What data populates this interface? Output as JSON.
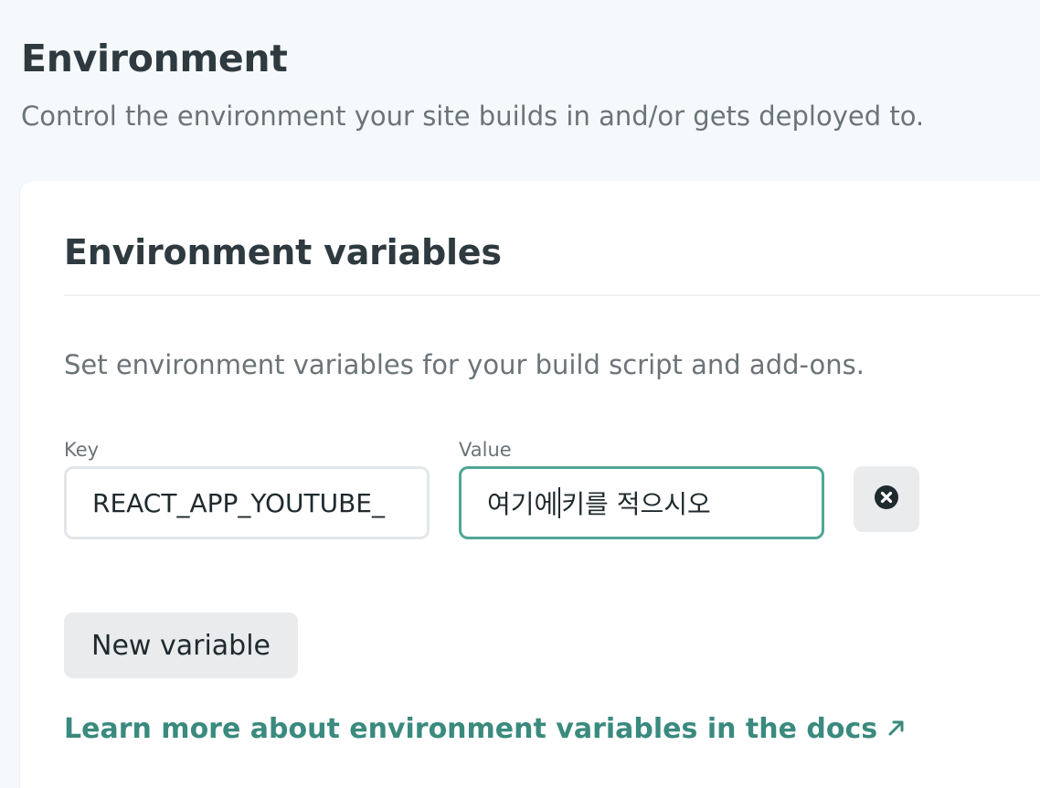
{
  "section": {
    "title": "Environment",
    "description": "Control the environment your site builds in and/or gets deployed to."
  },
  "card": {
    "title": "Environment variables",
    "description": "Set environment variables for your build script and add-ons.",
    "fields": {
      "key_label": "Key",
      "key_value": "REACT_APP_YOUTUBE_",
      "value_label": "Value",
      "value_before_caret": "여기에 ",
      "value_after_caret": "키를 적으시오"
    },
    "delete_icon": "close-circle-icon",
    "new_variable_label": "New variable",
    "docs_link_label": "Learn more about environment variables in the docs",
    "docs_link_icon": "arrow-up-right-icon"
  },
  "colors": {
    "accent": "#3a8a7e",
    "focus_border": "#4fa695",
    "background": "#f6f9fb"
  }
}
